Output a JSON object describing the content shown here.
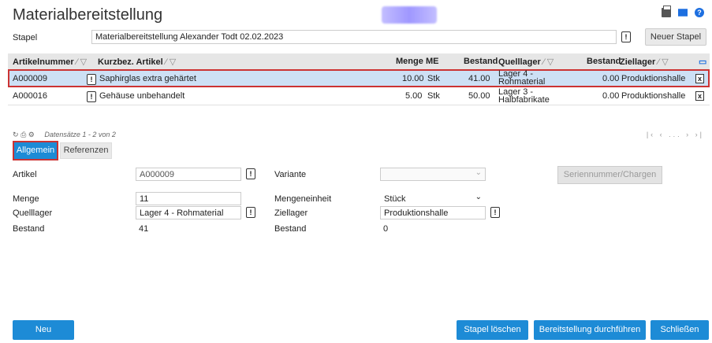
{
  "page": {
    "title": "Materialbereitstellung"
  },
  "stapel": {
    "label": "Stapel",
    "value": "Materialbereitstellung Alexander Todt 02.02.2023",
    "new_button": "Neuer Stapel"
  },
  "grid": {
    "columns": {
      "artikelnummer": "Artikelnummer",
      "kurzbez": "Kurzbez. Artikel",
      "menge": "Menge",
      "me": "ME",
      "bestand_q": "Bestand",
      "quelllager": "Quelllager",
      "bestand_z": "Bestand",
      "ziellager": "Ziellager"
    },
    "rows": [
      {
        "artikel": "A000009",
        "kurzbez": "Saphirglas extra gehärtet",
        "menge": "10.00",
        "me": "Stk",
        "bestand_q": "41.00",
        "quelllager_l1": "Lager 4 -",
        "quelllager_l2": "Rohmaterial",
        "bestand_z": "0.00",
        "ziellager": "Produktionshalle"
      },
      {
        "artikel": "A000016",
        "kurzbez": "Gehäuse unbehandelt",
        "menge": "5.00",
        "me": "Stk",
        "bestand_q": "50.00",
        "quelllager_l1": "Lager 3 -",
        "quelllager_l2": "Halbfabrikate",
        "bestand_z": "0.00",
        "ziellager": "Produktionshalle"
      }
    ],
    "records_info": "Datensätze 1 - 2 von 2",
    "pager": "|‹ ‹ ... › ›|"
  },
  "tabs": {
    "allgemein": "Allgemein",
    "referenzen": "Referenzen"
  },
  "form": {
    "artikel_label": "Artikel",
    "artikel_value": "A000009",
    "variante_label": "Variante",
    "variante_value": "",
    "serien_button": "Seriennummer/Chargen",
    "menge_label": "Menge",
    "menge_value": "11",
    "mengeneinheit_label": "Mengeneinheit",
    "mengeneinheit_value": "Stück",
    "quelllager_label": "Quelllager",
    "quelllager_value": "Lager 4 - Rohmaterial",
    "ziellager_label": "Ziellager",
    "ziellager_value": "Produktionshalle",
    "bestand_label": "Bestand",
    "bestand_value": "41",
    "bestand2_label": "Bestand",
    "bestand2_value": "0"
  },
  "footer": {
    "neu": "Neu",
    "stapel_loeschen": "Stapel löschen",
    "bereitstellung": "Bereitstellung durchführen",
    "schliessen": "Schließen"
  },
  "icons": {
    "print": "printer-icon",
    "mail": "mail-icon",
    "help": "help-icon",
    "refresh": "refresh-icon",
    "grid_print": "print-icon",
    "settings": "settings-icon",
    "export": "export-icon"
  },
  "colors": {
    "accent": "#1d8bd6",
    "selected_row": "#cde0f5",
    "highlight_border": "#cc3333"
  }
}
